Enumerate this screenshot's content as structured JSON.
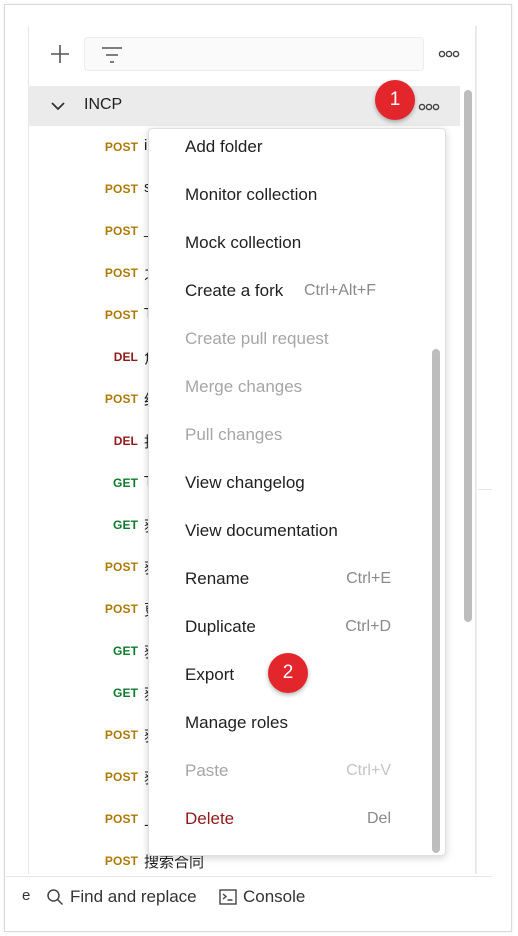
{
  "toolbar": {
    "add_icon": "plus-icon",
    "filter_icon": "filter-icon",
    "more_icon": "more-horizontal-icon"
  },
  "collection": {
    "name": "INCP",
    "expanded": true
  },
  "requests": [
    {
      "method": "POST",
      "name": "i"
    },
    {
      "method": "POST",
      "name": "s"
    },
    {
      "method": "POST",
      "name": "_"
    },
    {
      "method": "POST",
      "name": "之"
    },
    {
      "method": "POST",
      "name": "T"
    },
    {
      "method": "DEL",
      "name": "角"
    },
    {
      "method": "POST",
      "name": "红"
    },
    {
      "method": "DEL",
      "name": "批"
    },
    {
      "method": "GET",
      "name": "T"
    },
    {
      "method": "GET",
      "name": "获"
    },
    {
      "method": "POST",
      "name": "获"
    },
    {
      "method": "POST",
      "name": "更"
    },
    {
      "method": "GET",
      "name": "获"
    },
    {
      "method": "GET",
      "name": "获"
    },
    {
      "method": "POST",
      "name": "获"
    },
    {
      "method": "POST",
      "name": "获"
    },
    {
      "method": "POST",
      "name": "上"
    },
    {
      "method": "POST",
      "name": "搜索合同"
    }
  ],
  "menu": {
    "items": [
      {
        "label": "Add folder",
        "shortcut": "",
        "disabled": false
      },
      {
        "label": "Monitor collection",
        "shortcut": "",
        "disabled": false
      },
      {
        "label": "Mock collection",
        "shortcut": "",
        "disabled": false
      },
      {
        "label": "Create a fork",
        "shortcut": "Ctrl+Alt+F",
        "disabled": false
      },
      {
        "label": "Create pull request",
        "shortcut": "",
        "disabled": true
      },
      {
        "label": "Merge changes",
        "shortcut": "",
        "disabled": true
      },
      {
        "label": "Pull changes",
        "shortcut": "",
        "disabled": true
      },
      {
        "label": "View changelog",
        "shortcut": "",
        "disabled": false
      },
      {
        "label": "View documentation",
        "shortcut": "",
        "disabled": false
      },
      {
        "label": "Rename",
        "shortcut": "Ctrl+E",
        "disabled": false
      },
      {
        "label": "Duplicate",
        "shortcut": "Ctrl+D",
        "disabled": false
      },
      {
        "label": "Export",
        "shortcut": "",
        "disabled": false
      },
      {
        "label": "Manage roles",
        "shortcut": "",
        "disabled": false
      },
      {
        "label": "Paste",
        "shortcut": "Ctrl+V",
        "disabled": true
      },
      {
        "label": "Delete",
        "shortcut": "Del",
        "disabled": false,
        "danger": true
      }
    ]
  },
  "annotations": [
    {
      "label": "1"
    },
    {
      "label": "2"
    }
  ],
  "bottom_bar": {
    "partial": "e",
    "find_replace": "Find and replace",
    "console": "Console"
  },
  "colors": {
    "post": "#ad7a03",
    "del": "#8f1a1a",
    "get": "#0e7a2c",
    "badge": "#e3262c",
    "danger": "#8e1a1a",
    "disabled": "#a6a6a6"
  }
}
